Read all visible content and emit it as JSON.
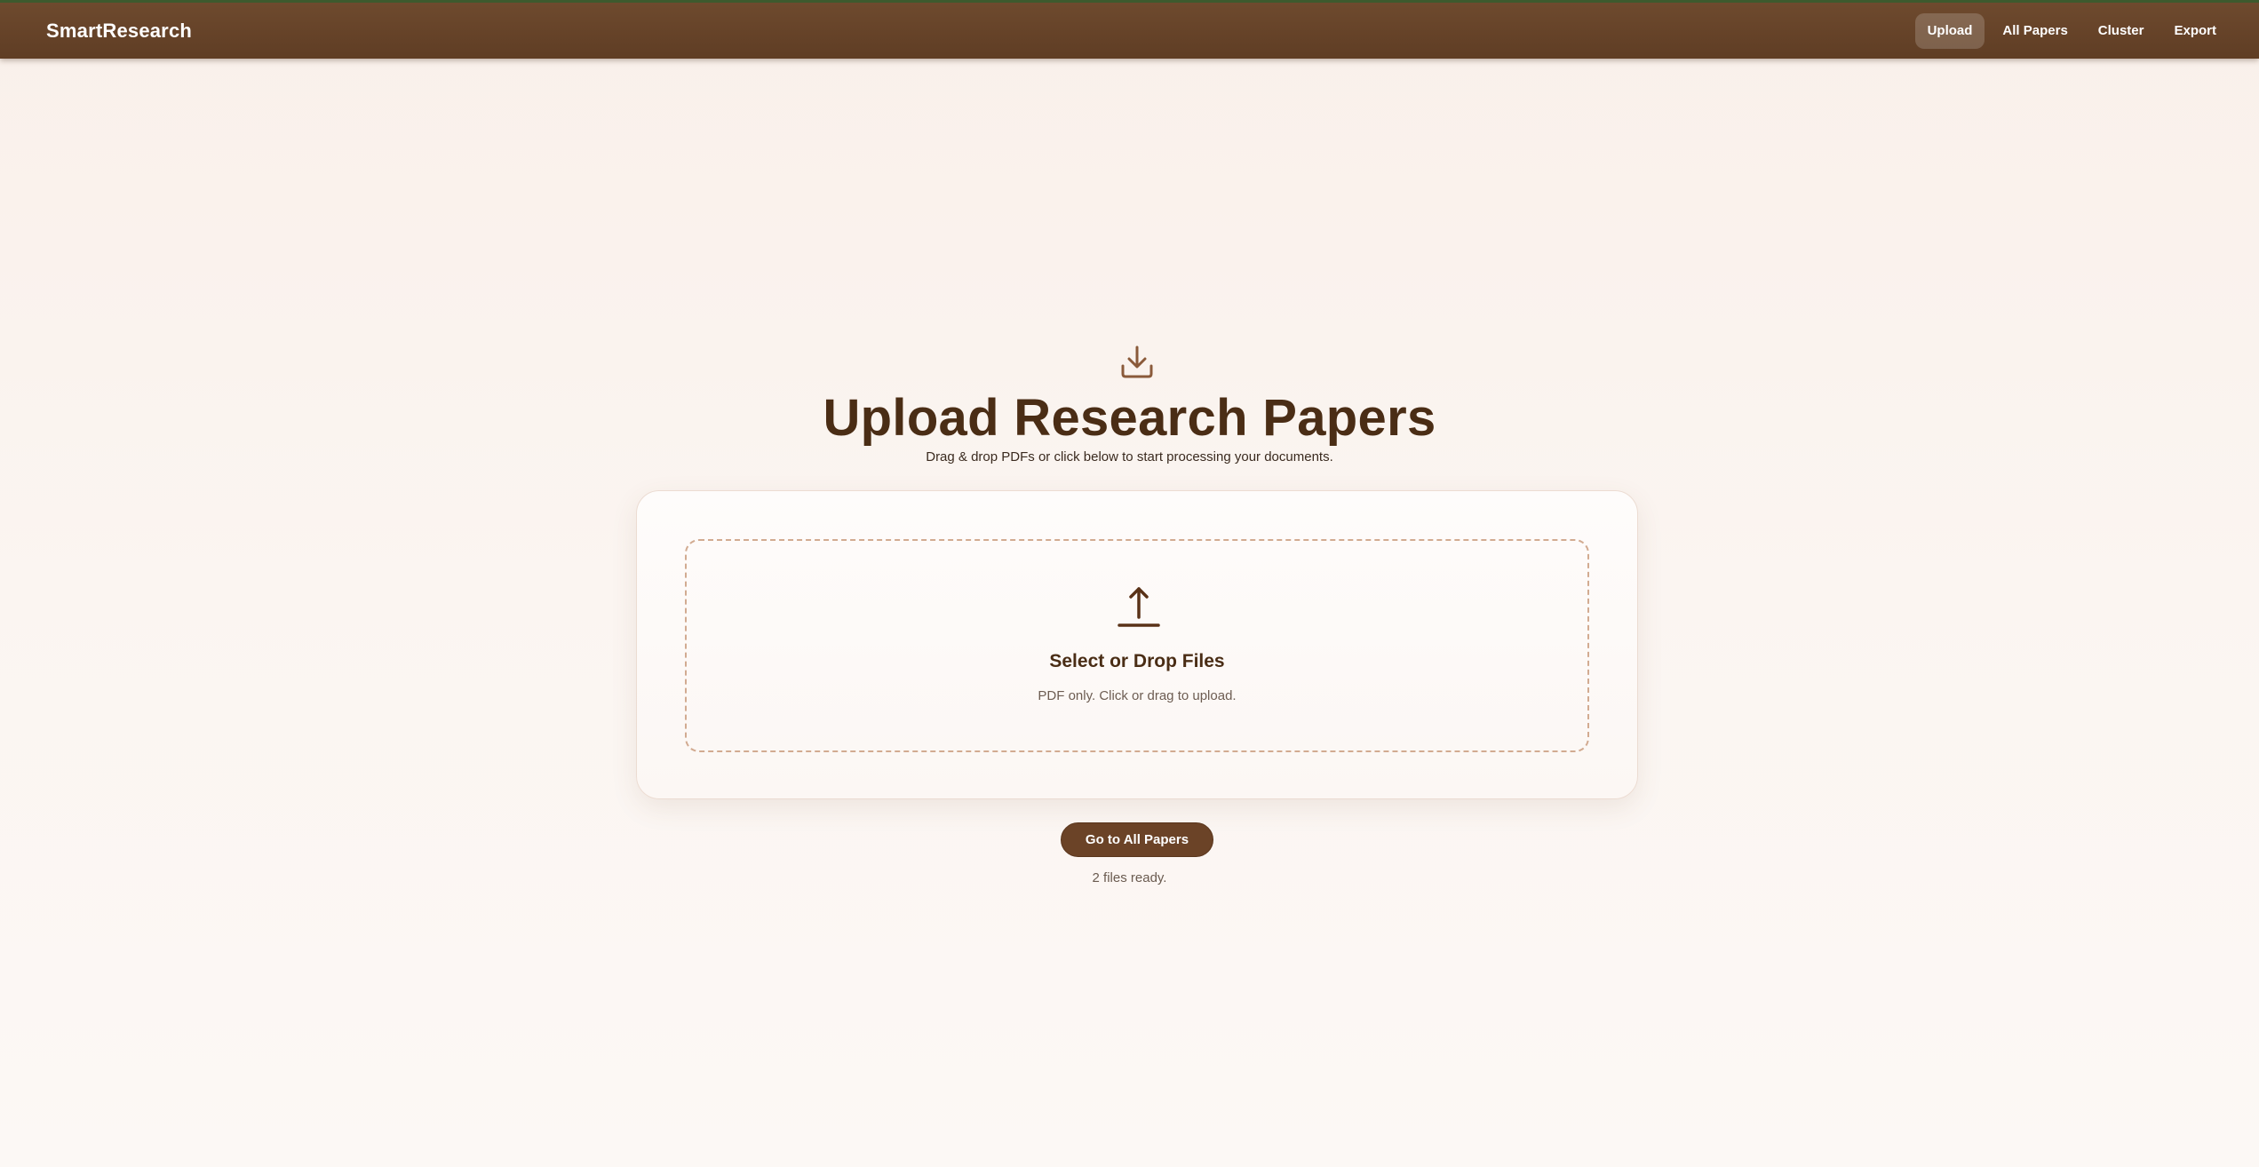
{
  "app": {
    "brand": "SmartResearch",
    "nav": [
      {
        "label": "Upload",
        "active": true
      },
      {
        "label": "All Papers",
        "active": false
      },
      {
        "label": "Cluster",
        "active": false
      },
      {
        "label": "Export",
        "active": false
      }
    ]
  },
  "hero": {
    "icon": "download-tray-icon",
    "title": "Upload Research Papers",
    "subtitle": "Drag & drop PDFs or click below to start processing your documents."
  },
  "dropzone": {
    "icon": "upload-arrow-icon",
    "title": "Select or Drop Files",
    "hint": "PDF only. Click or drag to upload."
  },
  "actions": {
    "go_all_papers": "Go to All Papers"
  },
  "status": {
    "text": "2 files ready."
  },
  "colors": {
    "navbar": "#6b4528",
    "accent_text": "#4a2d15",
    "button": "#6b4327",
    "dashed_border": "#d2ab91",
    "background": "#faf3ee"
  }
}
